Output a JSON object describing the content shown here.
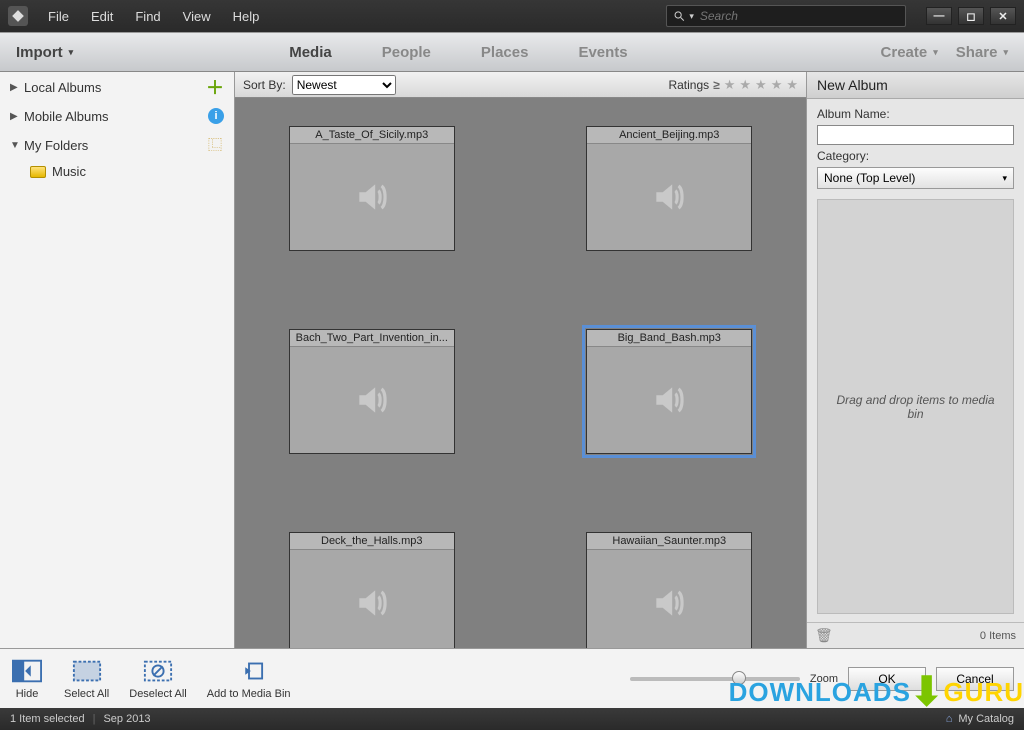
{
  "menubar": {
    "items": [
      "File",
      "Edit",
      "Find",
      "View",
      "Help"
    ],
    "search_placeholder": "Search"
  },
  "toolbar": {
    "import_label": "Import",
    "tabs": [
      "Media",
      "People",
      "Places",
      "Events"
    ],
    "active_tab": 0,
    "create_label": "Create",
    "share_label": "Share"
  },
  "sidebar": {
    "items": [
      {
        "label": "Local Albums",
        "expanded": false,
        "right_icon": "plus"
      },
      {
        "label": "Mobile Albums",
        "expanded": false,
        "right_icon": "info"
      },
      {
        "label": "My Folders",
        "expanded": true,
        "right_icon": "tree",
        "children": [
          {
            "label": "Music"
          }
        ]
      }
    ]
  },
  "sortbar": {
    "sort_by_label": "Sort By:",
    "sort_value": "Newest",
    "ratings_label": "Ratings"
  },
  "thumbs": [
    {
      "name": "A_Taste_Of_Sicily.mp3",
      "selected": false
    },
    {
      "name": "Ancient_Beijing.mp3",
      "selected": false
    },
    {
      "name": "Bach_Two_Part_Invention_in...",
      "selected": false
    },
    {
      "name": "Big_Band_Bash.mp3",
      "selected": true
    },
    {
      "name": "Deck_the_Halls.mp3",
      "selected": false
    },
    {
      "name": "Hawaiian_Saunter.mp3",
      "selected": false
    }
  ],
  "right_panel": {
    "title": "New Album",
    "album_name_label": "Album Name:",
    "album_name_value": "",
    "category_label": "Category:",
    "category_value": "None (Top Level)",
    "drop_text": "Drag and drop items to media bin",
    "items_count": "0 Items"
  },
  "action_bar": {
    "hide": "Hide",
    "select_all": "Select All",
    "deselect_all": "Deselect All",
    "add_to_bin": "Add to Media Bin",
    "zoom_label": "Zoom",
    "ok": "OK",
    "cancel": "Cancel"
  },
  "status": {
    "selected": "1 Item selected",
    "date": "Sep 2013",
    "catalog": "My Catalog"
  },
  "watermark": {
    "a": "DOWNLOADS",
    "b": "GURU"
  }
}
